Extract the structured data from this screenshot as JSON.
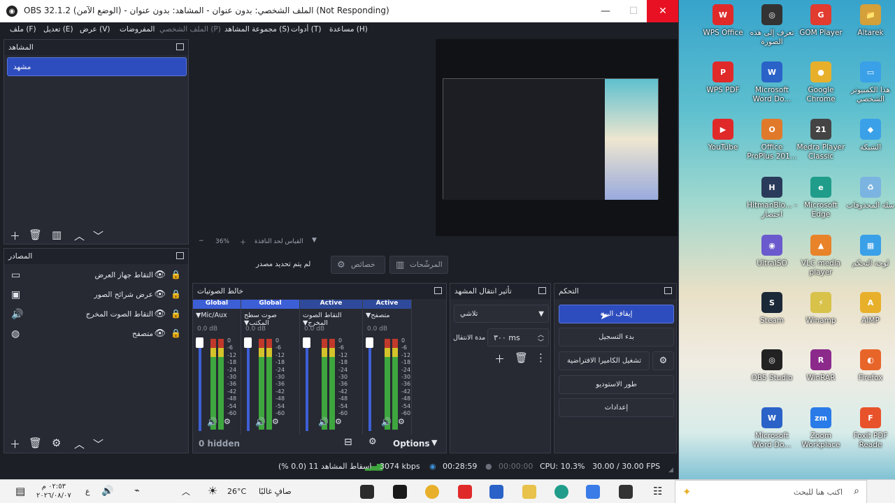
{
  "window": {
    "title": "OBS 32.1.2 (الوضع الآمن) - الملف الشخصي: بدون عنوان - المشاهد: بدون عنوان (Not Responding)",
    "minimize_icon": "minimize-icon",
    "maximize_icon": "maximize-icon",
    "close_icon": "close-icon"
  },
  "menu": [
    "ملف (F)",
    "تعديل (E)",
    "عرض (V)",
    "المفروضات",
    "الملف الشخصي (P)",
    "مجموعة المشاهد (S)",
    "أدوات (T)",
    "مساعدة (H)"
  ],
  "scenes": {
    "title": "المشاهد",
    "items": [
      "مشهد"
    ]
  },
  "preview": {
    "zoom": "36%",
    "status_text": "القياس لحد النافذة"
  },
  "source_toolbar": {
    "no_source": "لم يتم تحديد مصدر",
    "properties": "خصائص",
    "filters": "المرشّحات"
  },
  "sources": {
    "title": "المصادر",
    "items": [
      {
        "label": "التقاط جهاز العرض",
        "icon": "monitor-icon"
      },
      {
        "label": "عرض شرائح الصور",
        "icon": "slideshow-icon"
      },
      {
        "label": "التقاط الصوت المخرج",
        "icon": "speaker-icon"
      },
      {
        "label": "متصفح",
        "icon": "browser-icon"
      }
    ]
  },
  "mixer": {
    "title": "خالط الصوتيات",
    "hidden": "0 hidden",
    "options": "Options",
    "channels": [
      {
        "tag": "Global",
        "name": "Mic/Aux",
        "db": "0.0 dB",
        "tag_color": "#3d5fd6"
      },
      {
        "tag": "Global",
        "name": "صوت سطح المكتب",
        "db": "0.0 dB",
        "tag_color": "#3d5fd6"
      },
      {
        "tag": "Active",
        "name": "التقاط الصوت المخرج",
        "db": "0.0 dB",
        "tag_color": "#2f4a9a"
      },
      {
        "tag": "Active",
        "name": "متصفح",
        "db": "0.0 dB",
        "tag_color": "#2f4a9a"
      }
    ],
    "scale": [
      "0",
      "-6",
      "-12",
      "-18",
      "-24",
      "-30",
      "-36",
      "-42",
      "-48",
      "-54",
      "-60"
    ]
  },
  "transitions": {
    "title": "تأثير انتقال المشهد",
    "type": "تلاشي",
    "duration_label": "مدة الانتقال",
    "duration": "٣٠٠ ms"
  },
  "controls": {
    "title": "التحكم",
    "stop_stream": "إيقاف البث",
    "start_recording": "بدء التسجيل",
    "virtual_camera": "تشغيل الكاميرا الافتراضية",
    "studio_mode": "طور الاستوديو",
    "settings": "إعدادات"
  },
  "statusbar": {
    "dropped": "إسقاط المشاهد 11 (0.0 %)",
    "bitrate": "3074 kbps",
    "stream_time": "00:28:59",
    "record_time": "00:00:00",
    "cpu": "CPU: 10.3%",
    "fps": "30.00 / 30.00 FPS"
  },
  "desktop_icons": [
    {
      "label": "Altarek",
      "color": "#d4a03a",
      "glyph": "📁"
    },
    {
      "label": "GOM Player",
      "color": "#e23b2f",
      "glyph": "G"
    },
    {
      "label": "تعرف إلى هذه الصورة",
      "color": "#333",
      "glyph": "◎"
    },
    {
      "label": "WPS Office",
      "color": "#e02a2a",
      "glyph": "W"
    },
    {
      "label": "هذا الكمبيوتر الشخصي",
      "color": "#3aa0e8",
      "glyph": "▭"
    },
    {
      "label": "Google Chrome",
      "color": "#e8b02a",
      "glyph": "●"
    },
    {
      "label": "Microsoft Word Do...",
      "color": "#2a62c8",
      "glyph": "W"
    },
    {
      "label": "WPS PDF",
      "color": "#e02a2a",
      "glyph": "P"
    },
    {
      "label": "الشبكة",
      "color": "#3aa0e8",
      "glyph": "◆"
    },
    {
      "label": "Medra Player Classic",
      "color": "#444",
      "glyph": "21"
    },
    {
      "label": "Office ProPlus 201...",
      "color": "#e07a2a",
      "glyph": "O"
    },
    {
      "label": "YouTube",
      "color": "#e02a2a",
      "glyph": "▶"
    },
    {
      "label": "سلة المحذوفات",
      "color": "#7bb4e0",
      "glyph": "♻"
    },
    {
      "label": "Microsoft Edge",
      "color": "#1f9d8a",
      "glyph": "e"
    },
    {
      "label": "HitmanBlo... - اختصار",
      "color": "#2a3a5a",
      "glyph": "H"
    },
    {
      "label": "لوحة التحكم",
      "color": "#3aa0e8",
      "glyph": "▦"
    },
    {
      "label": "VLC media player",
      "color": "#e8832a",
      "glyph": "▲"
    },
    {
      "label": "UltraISO",
      "color": "#6a5acd",
      "glyph": "◉"
    },
    {
      "label": "AIMP",
      "color": "#e8b02a",
      "glyph": "A"
    },
    {
      "label": "Winamp",
      "color": "#d8c24a",
      "glyph": "⚡"
    },
    {
      "label": "Steam",
      "color": "#1b2838",
      "glyph": "S"
    },
    {
      "label": "Firefox",
      "color": "#e8652a",
      "glyph": "◐"
    },
    {
      "label": "WinRAR",
      "color": "#8b2a8b",
      "glyph": "R"
    },
    {
      "label": "OBS Studio",
      "color": "#222",
      "glyph": "◎"
    },
    {
      "label": "Foxit PDF Reade",
      "color": "#e8522a",
      "glyph": "F"
    },
    {
      "label": "Zoom Workplace",
      "color": "#2a7be8",
      "glyph": "zm"
    },
    {
      "label": "Microsoft Word Do...",
      "color": "#2a62c8",
      "glyph": "W"
    }
  ],
  "taskbar": {
    "search": "اكتب هنا للبحث",
    "weather": "صافٍ غالبًا",
    "temp": "26°C",
    "time": "٠٢:٥٣ م",
    "date": "٢٠٢٦/٠٨/٠٧",
    "lang": "ع"
  }
}
